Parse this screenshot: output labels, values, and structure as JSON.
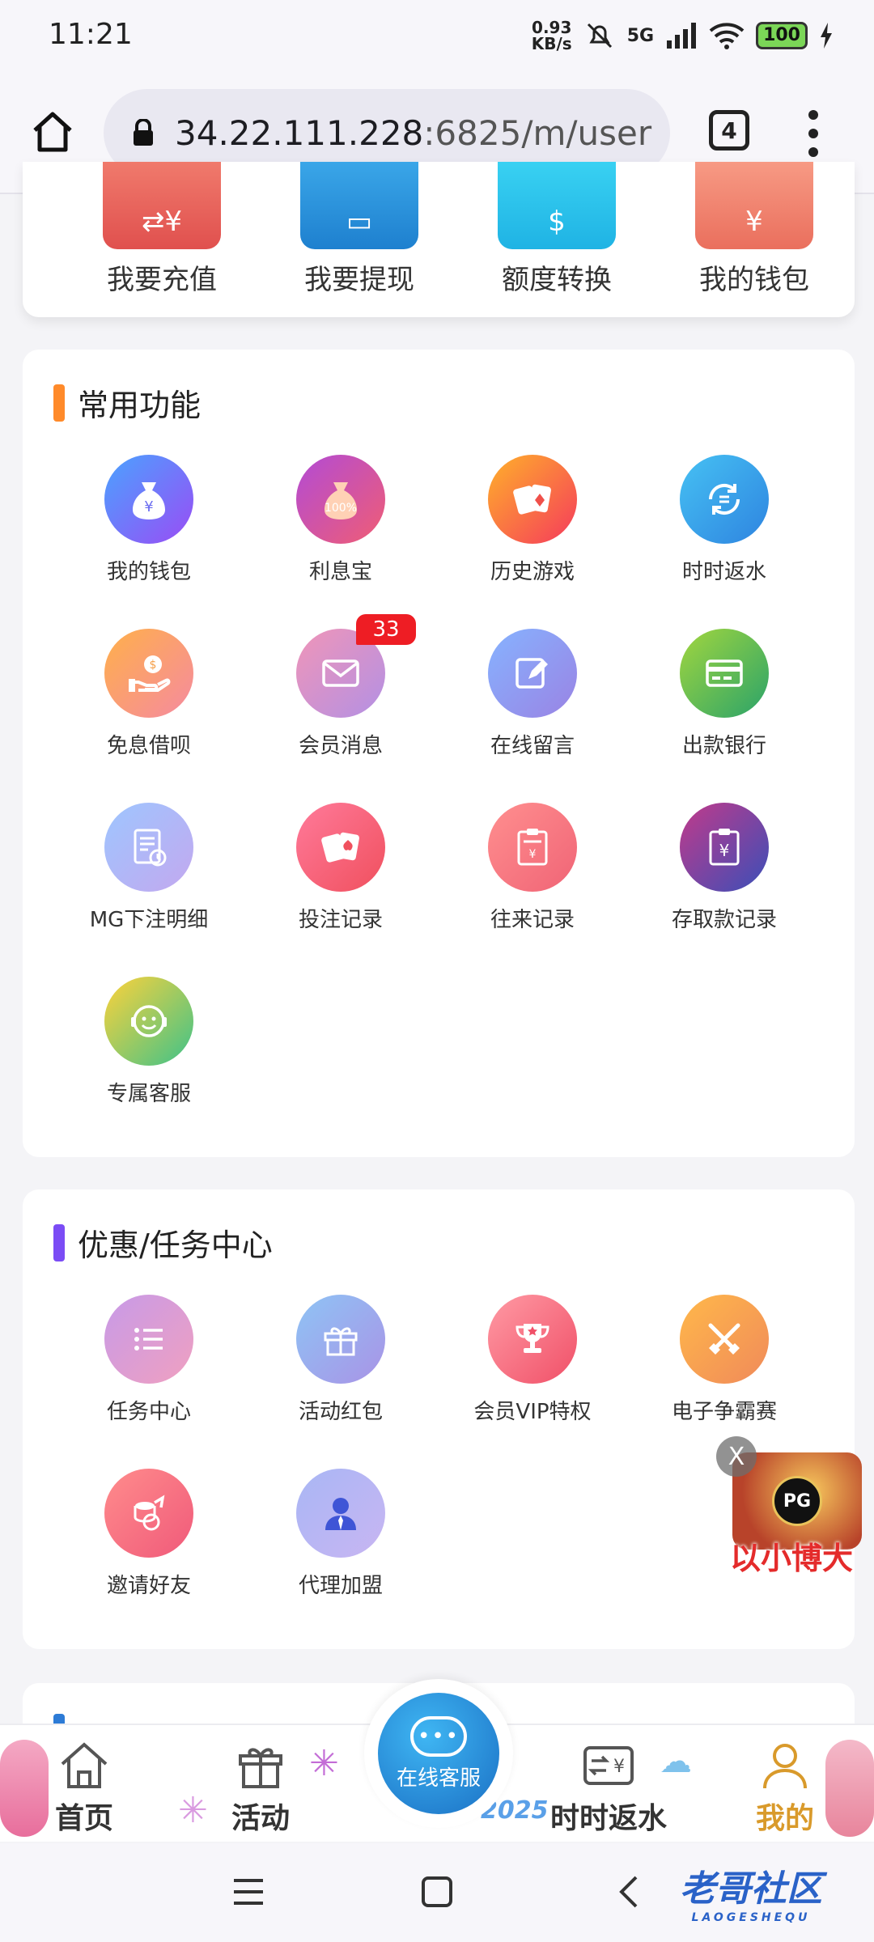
{
  "status_bar": {
    "time": "11:21",
    "net_speed_value": "0.93",
    "net_speed_unit": "KB/s",
    "network": "5G",
    "battery": "100"
  },
  "browser": {
    "url_host": "34.22.111.228",
    "url_rest": ":6825/m/user",
    "tab_count": "4"
  },
  "wallet_bar": {
    "items": [
      {
        "label": "我要充值",
        "icon": "recharge-icon",
        "color": "#e8605e"
      },
      {
        "label": "我要提现",
        "icon": "withdraw-icon",
        "color": "#2a8fd6"
      },
      {
        "label": "额度转换",
        "icon": "transfer-icon",
        "color": "#2cc3ea"
      },
      {
        "label": "我的钱包",
        "icon": "wallet-icon",
        "color": "#f0806a"
      }
    ]
  },
  "common_functions": {
    "title": "常用功能",
    "accent": "#ff8a2a",
    "items": [
      {
        "label": "我的钱包",
        "icon": "money-bag-icon"
      },
      {
        "label": "利息宝",
        "icon": "interest-bag-icon",
        "glyph": "100%"
      },
      {
        "label": "历史游戏",
        "icon": "playing-cards-icon"
      },
      {
        "label": "时时返水",
        "icon": "rebate-cycle-icon"
      },
      {
        "label": "免息借呗",
        "icon": "loan-hand-icon"
      },
      {
        "label": "会员消息",
        "icon": "envelope-icon",
        "badge": "33"
      },
      {
        "label": "在线留言",
        "icon": "edit-note-icon"
      },
      {
        "label": "出款银行",
        "icon": "bank-card-icon"
      },
      {
        "label": "MG下注明细",
        "icon": "bet-detail-icon"
      },
      {
        "label": "投注记录",
        "icon": "bet-cards-icon"
      },
      {
        "label": "往来记录",
        "icon": "ledger-icon"
      },
      {
        "label": "存取款记录",
        "icon": "clipboard-yen-icon"
      },
      {
        "label": "专属客服",
        "icon": "smile-headset-icon"
      }
    ]
  },
  "promo_center": {
    "title": "优惠/任务中心",
    "accent": "#7b4cf5",
    "items": [
      {
        "label": "任务中心",
        "icon": "task-list-icon"
      },
      {
        "label": "活动红包",
        "icon": "gift-box-icon"
      },
      {
        "label": "会员VIP特权",
        "icon": "trophy-icon"
      },
      {
        "label": "电子争霸赛",
        "icon": "crossed-swords-icon"
      },
      {
        "label": "邀请好友",
        "icon": "invite-share-icon"
      },
      {
        "label": "代理加盟",
        "icon": "agent-person-icon"
      }
    ]
  },
  "floating_promo": {
    "close_label": "X",
    "logo_text": "PG",
    "slogan": "以小博大"
  },
  "bottom_nav": {
    "items": [
      {
        "label": "首页",
        "icon": "home-outline-icon"
      },
      {
        "label": "活动",
        "icon": "gift-outline-icon"
      },
      {
        "label": "在线客服",
        "icon": "chat-bubble-icon"
      },
      {
        "label": "时时返水",
        "icon": "rebate-icon"
      },
      {
        "label": "我的",
        "icon": "person-outline-icon"
      }
    ],
    "active_color": "#d99a2b",
    "deco_text": "2025"
  },
  "watermark": {
    "text": "老哥社区",
    "sub": "LAOGESHEQU"
  }
}
